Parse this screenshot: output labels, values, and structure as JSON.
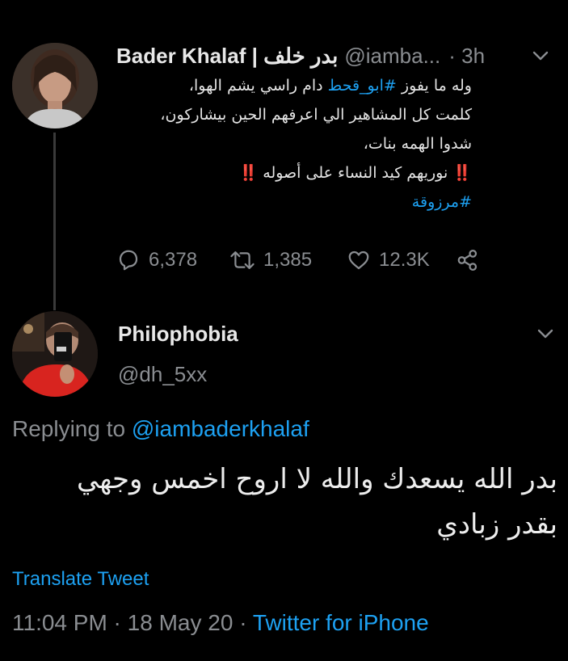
{
  "tweet1": {
    "display_name": "Bader Khalaf | بدر خلف",
    "handle": "@iamba...",
    "time": "· 3h",
    "body_lines": [
      {
        "pre": "وله ما يفوز ",
        "hashtag": "#ابو_قحط",
        "post": " دام راسي يشم الهوا،"
      },
      {
        "text": "كلمت كل المشاهير الي اعرفهم الحين بيشاركون،"
      },
      {
        "text": "شدوا الهمه بنات،"
      },
      {
        "bang1": "‼️",
        "text": " نوريهم كيد النساء على أصوله ",
        "bang2": "‼️"
      }
    ],
    "hashtag_line": "#مرزوقة",
    "counts": {
      "replies": "6,378",
      "retweets": "1,385",
      "likes": "12.3K"
    }
  },
  "tweet2": {
    "display_name": "Philophobia",
    "handle": "@dh_5xx",
    "replying_prefix": "Replying to ",
    "replying_mention": "@iambaderkhalaf",
    "body_lines": [
      "بدر الله يسعدك والله لا اروح اخمس وجهي",
      "بقدر زبادي"
    ],
    "translate": "Translate Tweet",
    "time": "11:04 PM",
    "date": "18 May 20",
    "source": "Twitter for iPhone"
  },
  "icons": [
    "chevron-down-icon",
    "reply-icon",
    "retweet-icon",
    "like-icon",
    "share-icon"
  ],
  "colors": {
    "background": "#000000",
    "link": "#1da1f2",
    "muted": "#8a8d91",
    "text": "#e8e8e8",
    "alert": "#e0245e"
  }
}
